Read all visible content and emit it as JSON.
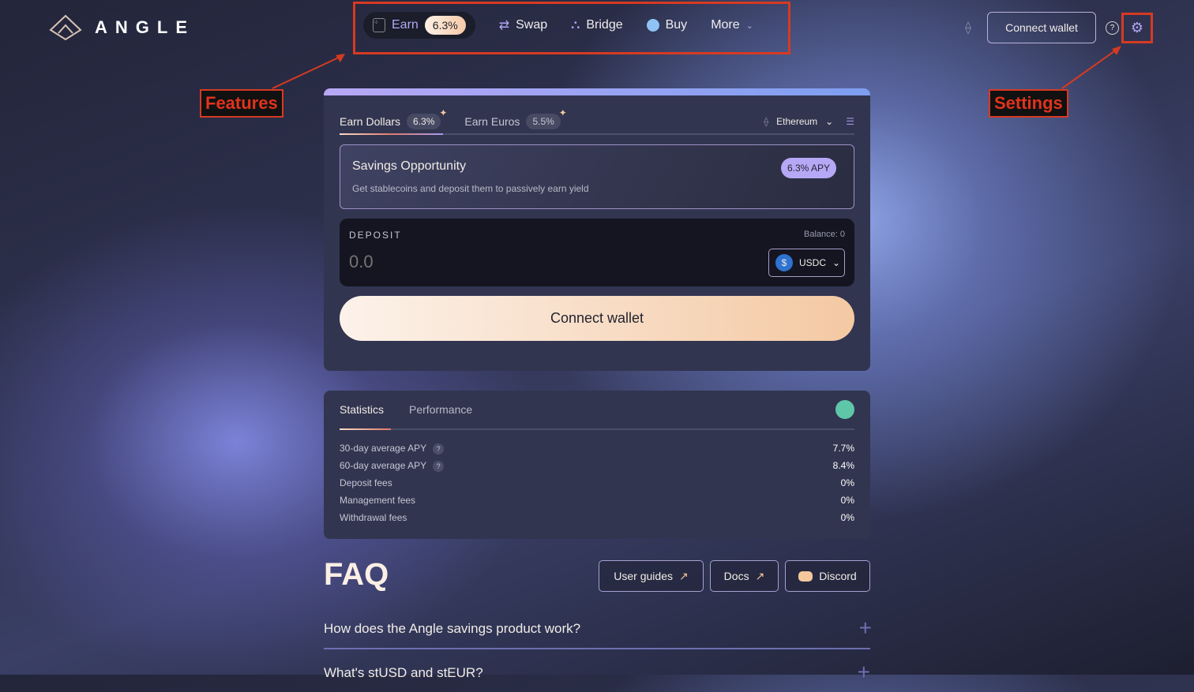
{
  "header": {
    "logo_text": "ANGLE",
    "nav": [
      {
        "label": "Earn",
        "badge": "6.3%"
      },
      {
        "label": "Swap"
      },
      {
        "label": "Bridge"
      },
      {
        "label": "Buy"
      },
      {
        "label": "More"
      }
    ],
    "connect_wallet": "Connect wallet"
  },
  "annotations": {
    "features": "Features",
    "settings": "Settings"
  },
  "earn_card": {
    "tabs": [
      {
        "label": "Earn Dollars",
        "badge": "6.3%"
      },
      {
        "label": "Earn Euros",
        "badge": "5.5%"
      }
    ],
    "network": "Ethereum",
    "opportunity": {
      "title": "Savings Opportunity",
      "subtitle": "Get stablecoins and deposit them to passively earn yield",
      "apy": "6.3% APY"
    },
    "deposit": {
      "label": "DEPOSIT",
      "balance": "Balance: 0",
      "placeholder": "0.0",
      "token": "USDC"
    },
    "connect_wallet": "Connect wallet"
  },
  "stats": {
    "tabs": [
      "Statistics",
      "Performance"
    ],
    "rows": [
      {
        "label": "30-day average APY",
        "value": "7.7%"
      },
      {
        "label": "60-day average APY",
        "value": "8.4%"
      },
      {
        "label": "Deposit fees",
        "value": "0%"
      },
      {
        "label": "Management fees",
        "value": "0%"
      },
      {
        "label": "Withdrawal fees",
        "value": "0%"
      }
    ]
  },
  "faq": {
    "title": "FAQ",
    "buttons": [
      "User guides",
      "Docs",
      "Discord"
    ],
    "questions": [
      "How does the Angle savings product work?",
      "What's stUSD and stEUR?"
    ]
  }
}
